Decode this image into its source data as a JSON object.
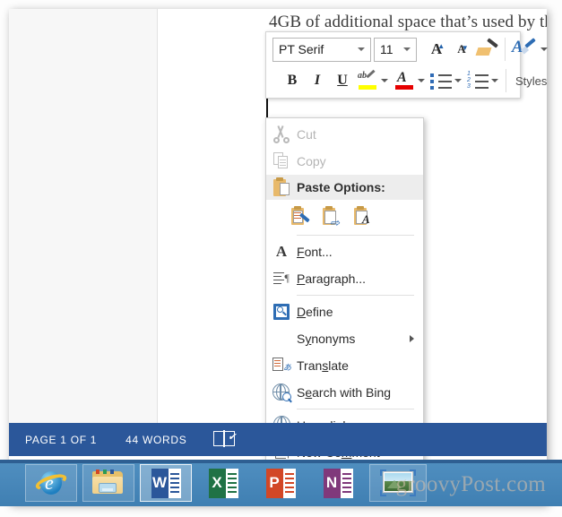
{
  "document": {
    "body_text": "4GB of additional space that’s used by the"
  },
  "mini_toolbar": {
    "font_name": "PT Serif",
    "font_size": "11",
    "buttons": [
      {
        "name": "grow-font",
        "label": "A"
      },
      {
        "name": "shrink-font",
        "label": "A"
      },
      {
        "name": "format-painter",
        "label": ""
      },
      {
        "name": "text-effects",
        "label": "A"
      },
      {
        "name": "bold",
        "label": "B"
      },
      {
        "name": "italic",
        "label": "I"
      },
      {
        "name": "underline",
        "label": "U"
      },
      {
        "name": "text-highlight-color",
        "label": "ab"
      },
      {
        "name": "font-color",
        "label": "A"
      },
      {
        "name": "bullets",
        "label": ""
      },
      {
        "name": "numbering",
        "label": ""
      }
    ],
    "styles_label": "Styles",
    "highlight_color": "#ffff00",
    "font_color": "#e60000"
  },
  "context_menu": {
    "items": [
      {
        "label": "Cut",
        "accel": "t",
        "icon": "scissors-icon",
        "disabled": true
      },
      {
        "label": "Copy",
        "accel": "C",
        "icon": "copy-icon",
        "disabled": true
      },
      {
        "label": "Paste Options:",
        "icon": "clipboard-icon",
        "header": true
      },
      {
        "label": "Font...",
        "accel": "F",
        "icon": "font-icon"
      },
      {
        "label": "Paragraph...",
        "accel": "P",
        "icon": "paragraph-icon"
      },
      {
        "label": "Define",
        "accel": "D",
        "icon": "define-icon"
      },
      {
        "label": "Synonyms",
        "accel": "y",
        "icon": "none",
        "submenu": true
      },
      {
        "label": "Translate",
        "accel": "s",
        "icon": "translate-icon"
      },
      {
        "label": "Search with Bing",
        "accel": "e",
        "icon": "search-bing-icon"
      },
      {
        "label": "Hyperlink...",
        "accel": "H",
        "icon": "hyperlink-icon"
      },
      {
        "label": "New Comment",
        "accel": "m",
        "icon": "new-comment-icon"
      }
    ],
    "paste_options": [
      {
        "name": "paste-keep-source-formatting"
      },
      {
        "name": "paste-merge-formatting"
      },
      {
        "name": "paste-keep-text-only"
      }
    ]
  },
  "status_bar": {
    "page": "PAGE 1 OF 1",
    "words": "44 WORDS",
    "proofing_icon": "proofing-errors-icon",
    "background": "#2b579a"
  },
  "taskbar": {
    "items": [
      {
        "name": "internet-explorer",
        "state": "normal"
      },
      {
        "name": "file-explorer",
        "state": "normal"
      },
      {
        "name": "word",
        "state": "active",
        "letter": "W"
      },
      {
        "name": "excel",
        "state": "normal",
        "letter": "X"
      },
      {
        "name": "powerpoint",
        "state": "normal",
        "letter": "P"
      },
      {
        "name": "onenote",
        "state": "normal",
        "letter": "N"
      },
      {
        "name": "picture-viewer",
        "state": "hover"
      }
    ]
  },
  "watermark": {
    "text": "groovyPost.com"
  }
}
